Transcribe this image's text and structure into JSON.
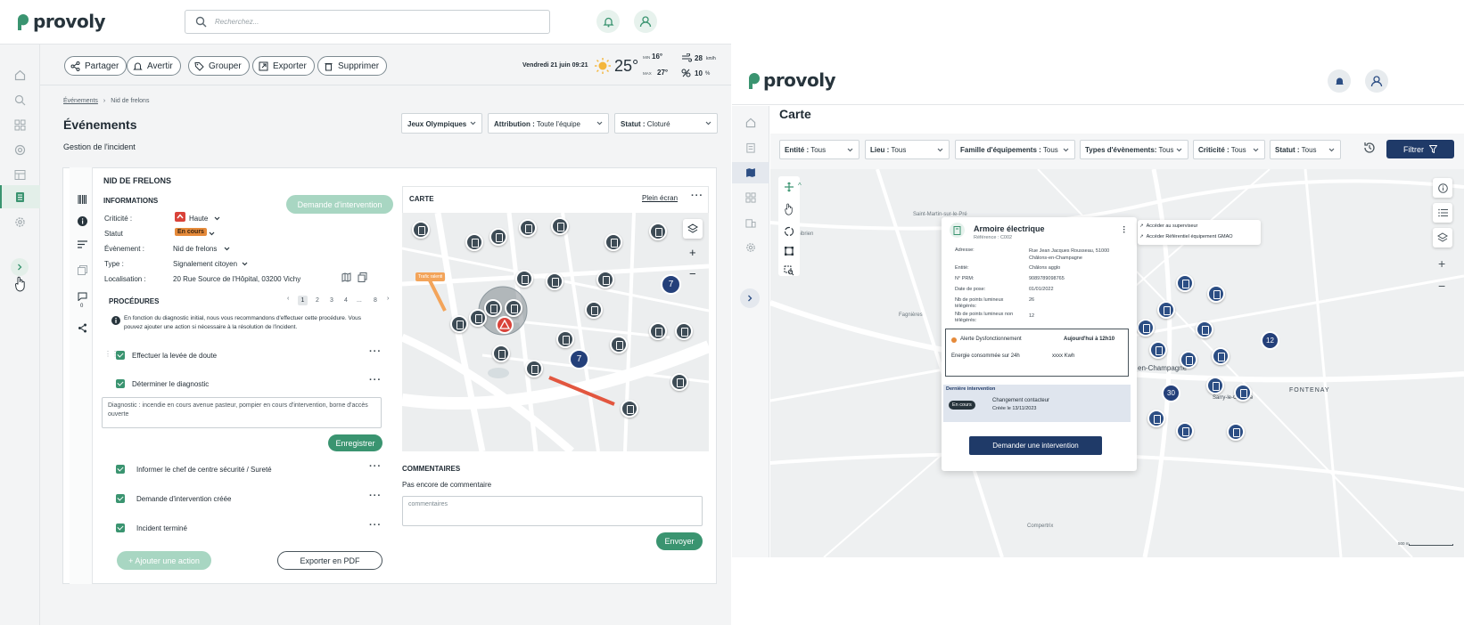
{
  "colors": {
    "brand_green": "#3a9470",
    "brand_navy": "#1f3a68",
    "cluster_blue": "#24407a",
    "alert_red": "#d9433a",
    "badge_orange": "#e58a3a"
  },
  "left": {
    "logo": "provoly",
    "search_placeholder": "Recherchez...",
    "toolbar": [
      "Partager",
      "Avertir",
      "Grouper",
      "Exporter",
      "Supprimer"
    ],
    "weather": {
      "date": "Vendredi 21 juin 09:21",
      "temp": "25°",
      "min_label": "MIN",
      "min": "16°",
      "max_label": "MAX",
      "max": "27°",
      "wind": "28",
      "wind_unit": "km/h",
      "humidity": "10",
      "humidity_unit": "%"
    },
    "breadcrumb": [
      "Événements",
      "Nid de frelons"
    ],
    "title": "Événements",
    "subtitle": "Gestion de l'incident",
    "filters": [
      {
        "label": "",
        "value": "Jeux Olympiques"
      },
      {
        "label": "Attribution :",
        "value": "Toute l'équipe"
      },
      {
        "label": "Statut :",
        "value": "Cloturé"
      }
    ],
    "incident": {
      "name": "NID DE FRELONS",
      "info_heading": "INFORMATIONS",
      "request_button": "Demande d'intervention",
      "fields": [
        {
          "label": "Criticité :",
          "value": "Haute"
        },
        {
          "label": "Statut",
          "value": "En cours"
        },
        {
          "label": "Évènement :",
          "value": "Nid de frelons"
        },
        {
          "label": "Type :",
          "value": "Signalement citoyen"
        },
        {
          "label": "Localisation :",
          "value": "20 Rue Source de l'Hôpital, 03200 Vichy"
        }
      ],
      "comment_count": "0",
      "procedures_heading": "PROCÉDURES",
      "pagination": [
        "1",
        "2",
        "3",
        "4",
        "...",
        "8"
      ],
      "notice": "En fonction du diagnostic initial, nous vous recommandons d'effectuer cette procédure. Vous pouvez ajouter une action si nécessaire à la résolution de l'incident.",
      "steps_top": [
        "Effectuer la levée de doute",
        "Déterminer le diagnostic"
      ],
      "diagnostic_text": "Diagnostic : incendie en cours avenue pasteur, pompier en cours d'intervention, borne d'accès ouverte",
      "save_button": "Enregistrer",
      "steps_bottom": [
        "Informer le chef de centre sécurité / Sureté",
        "Demande d'intervention créée",
        "Incident terminé"
      ],
      "add_action": "+ Ajouter une action",
      "export_pdf": "Exporter en PDF"
    },
    "map": {
      "heading": "CARTE",
      "fullscreen": "Plein écran",
      "cluster_a": "7",
      "cluster_b": "7",
      "road_tag": "Trafic ralenti",
      "zoom_in": "+",
      "zoom_out": "−"
    },
    "comments": {
      "heading": "COMMENTAIRES",
      "empty": "Pas encore de commentaire",
      "placeholder": "commentaires",
      "send": "Envoyer"
    }
  },
  "right": {
    "logo": "provoly",
    "page_title": "Carte",
    "filters": [
      {
        "label": "Entité :",
        "value": "Tous"
      },
      {
        "label": "Lieu :",
        "value": "Tous"
      },
      {
        "label": "Famille d'équipements :",
        "value": "Tous"
      },
      {
        "label": "Types d'évènements:",
        "value": "Tous"
      },
      {
        "label": "Criticité :",
        "value": "Tous"
      },
      {
        "label": "Statut :",
        "value": "Tous"
      }
    ],
    "filter_button": "Filtrer",
    "map_labels": [
      "Saint-Martin-sur-le-Pré",
      "Gibrien",
      "Fagnières",
      "en-Champagne",
      "FONTENAY",
      "Sarry-le-Commie",
      "Compertrix"
    ],
    "clusters": [
      "12",
      "30"
    ],
    "scale": "500 m",
    "popup": {
      "title": "Armoire électrique",
      "reference": "Référence : C002",
      "rows": [
        {
          "label": "Adresse:",
          "value": "Rue Jean Jacques Rousseau, 51000 Châlons-en-Champagne"
        },
        {
          "label": "Entité:",
          "value": "Châlons agglo"
        },
        {
          "label": "N° PRM:",
          "value": "9089789098765"
        },
        {
          "label": "Date de pose:",
          "value": "01/01/2022"
        },
        {
          "label": "Nb de points lumineux télégérés:",
          "value": "26"
        },
        {
          "label": "Nb de points lumineux non télégérés:",
          "value": "12"
        }
      ],
      "alert_title": "Alerte Dysfonctionnement",
      "alert_time": "Aujourd'hui à 12h10",
      "energy_label": "Energie consommée sur 24h",
      "energy_value": "xxxx Kwh",
      "last_heading": "Dernière intervention",
      "last_badge": "En cours",
      "last_title": "Changement contacteur",
      "last_date": "Créée le 13/11/2023",
      "cta": "Demander une intervention",
      "links": [
        "Accéder au superviseur",
        "Accéder Référentiel équipement GMAO"
      ]
    }
  }
}
